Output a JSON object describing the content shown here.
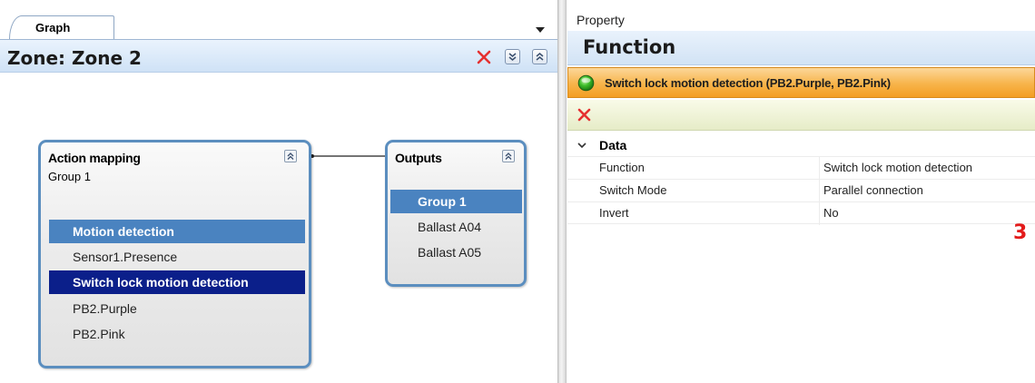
{
  "graph": {
    "tab_label": "Graph",
    "zone_title": "Zone: Zone 2",
    "action_node": {
      "title": "Action mapping",
      "subtitle": "Group 1",
      "rows": [
        {
          "label": "Motion detection",
          "state": "selected-light"
        },
        {
          "label": "Sensor1.Presence",
          "state": "normal"
        },
        {
          "label": "Switch lock motion detection",
          "state": "selected-dark"
        },
        {
          "label": "PB2.Purple",
          "state": "normal"
        },
        {
          "label": "PB2.Pink",
          "state": "normal"
        }
      ]
    },
    "outputs_node": {
      "title": "Outputs",
      "rows": [
        {
          "label": "Group 1",
          "state": "selected-light"
        },
        {
          "label": "Ballast A04",
          "state": "normal"
        },
        {
          "label": "Ballast A05",
          "state": "normal"
        }
      ]
    }
  },
  "property": {
    "caption": "Property",
    "title": "Function",
    "selected_item": "Switch lock motion detection (PB2.Purple, PB2.Pink)",
    "category": "Data",
    "rows": [
      {
        "name": "Function",
        "value": "Switch lock motion detection"
      },
      {
        "name": "Switch Mode",
        "value": "Parallel connection"
      },
      {
        "name": "Invert",
        "value": "No"
      }
    ]
  },
  "annotation": {
    "step": "3"
  },
  "colors": {
    "node_border": "#5b8ebf",
    "row_selected_light": "#4a83c0",
    "row_selected_dark": "#0b1f8a",
    "selected_bar": "#f7b44a",
    "delete_red": "#e53030",
    "step_red": "#e31b1b"
  }
}
